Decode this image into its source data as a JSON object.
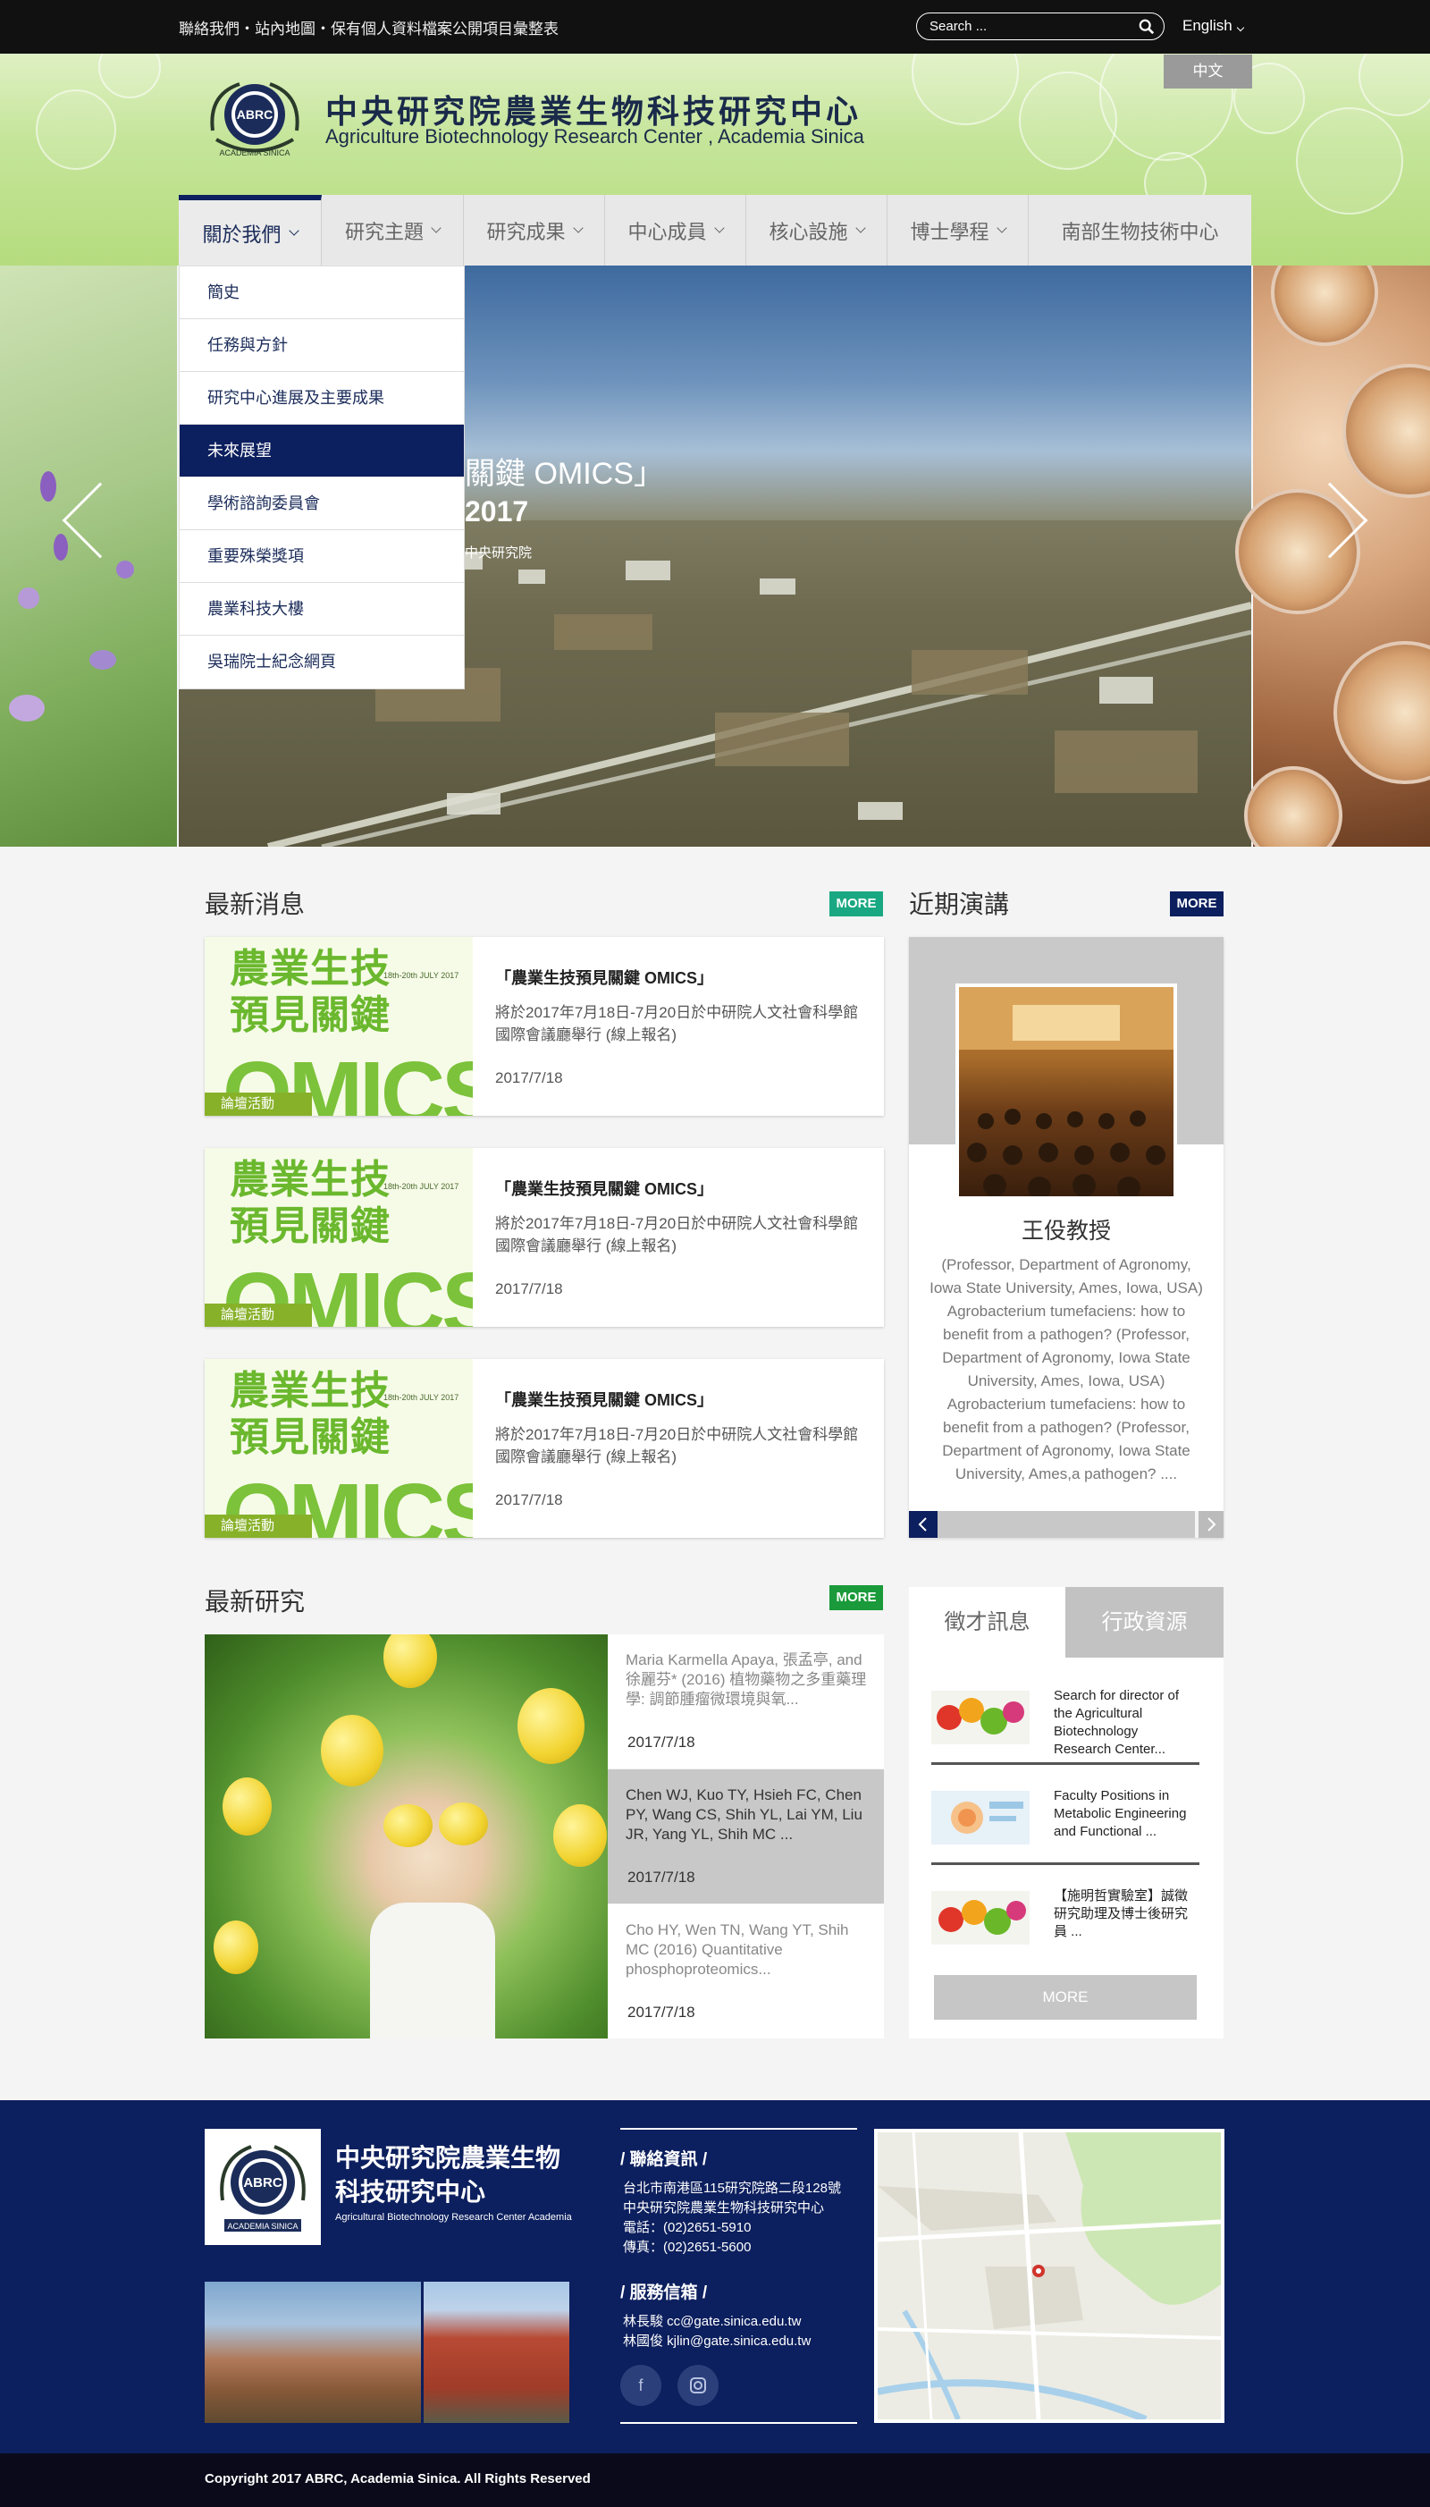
{
  "topbar": {
    "links": "聯絡我們・站內地圖・保有個人資料檔案公開項目彙整表",
    "search_placeholder": "Search ...",
    "language": "English"
  },
  "header": {
    "logo_text_top": "ABRC",
    "logo_text_bottom": "ACADEMIA SINICA",
    "title_cn": "中央研究院農業生物科技研究中心",
    "title_en": "Agriculture Biotechnology Research Center , Academia Sinica",
    "zh_button": "中文"
  },
  "nav": {
    "items": [
      {
        "label": "關於我們",
        "has_sub": true
      },
      {
        "label": "研究主題",
        "has_sub": true
      },
      {
        "label": "研究成果",
        "has_sub": true
      },
      {
        "label": "中心成員",
        "has_sub": true
      },
      {
        "label": "核心設施",
        "has_sub": true
      },
      {
        "label": "博士學程",
        "has_sub": true
      },
      {
        "label": "南部生物技術中心",
        "has_sub": false
      }
    ],
    "active_index": 0
  },
  "dropdown": {
    "items": [
      "簡史",
      "任務與方針",
      "研究中心進展及主要成果",
      "未來展望",
      "學術諮詢委員會",
      "重要殊榮獎項",
      "農業科技大樓",
      "吳瑞院士紀念網頁"
    ],
    "active_index": 3
  },
  "hero": {
    "line1": "關鍵 OMICS」",
    "line2": "2017",
    "line3": "中央研究院"
  },
  "news": {
    "title": "最新消息",
    "more": "MORE",
    "more_color": "#1aa882",
    "image_text_cn": "農業生技\n預見關鍵",
    "image_text_big": "OMICS",
    "image_date": "18th-20th JULY 2017",
    "items": [
      {
        "tag": "論壇活動",
        "title": "「農業生技預見關鍵 OMICS」",
        "desc": "將於2017年7月18日-7月20日於中研院人文社會科學館國際會議廳舉行 (線上報名)",
        "date": "2017/7/18"
      },
      {
        "tag": "論壇活動",
        "title": "「農業生技預見關鍵 OMICS」",
        "desc": "將於2017年7月18日-7月20日於中研院人文社會科學館國際會議廳舉行 (線上報名)",
        "date": "2017/7/18"
      },
      {
        "tag": "論壇活動",
        "title": "「農業生技預見關鍵 OMICS」",
        "desc": "將於2017年7月18日-7月20日於中研院人文社會科學館國際會議廳舉行 (線上報名)",
        "date": "2017/7/18"
      }
    ]
  },
  "lecture": {
    "title": "近期演講",
    "more": "MORE",
    "more_color": "#0c1f5e",
    "name": "王伇教授",
    "affil": "(Professor, Department of Agronomy, Iowa State University, Ames, Iowa, USA)",
    "text": "Agrobacterium tumefaciens: how to benefit from a pathogen?  (Professor, Department of Agronomy, Iowa State University, Ames, Iowa, USA) Agrobacterium tumefaciens: how to benefit from a pathogen?  (Professor, Department of Agronomy, Iowa State University, Ames,a pathogen? ...."
  },
  "research": {
    "title": "最新研究",
    "more": "MORE",
    "more_color": "#1a9a3a",
    "items": [
      {
        "text": "Maria Karmella Apaya, 張孟亭, and 徐麗芬* (2016) 植物藥物之多重藥理學: 調節腫瘤微環境與氧...",
        "date": "2017/7/18",
        "active": false
      },
      {
        "text": "Chen WJ, Kuo TY, Hsieh FC, Chen PY, Wang CS, Shih YL, Lai YM, Liu JR, Yang YL, Shih MC ...",
        "date": "2017/7/18",
        "active": true
      },
      {
        "text": "Cho HY, Wen TN, Wang YT, Shih MC (2016) Quantitative phosphoproteomics...",
        "date": "2017/7/18",
        "active": false
      }
    ]
  },
  "recruit": {
    "tab_active": "徵才訊息",
    "tab_inactive": "行政資源",
    "items": [
      "Search for director of the Agricultural Biotechnology Research Center...",
      "Faculty Positions in Metabolic Engineering and Functional  ...",
      "【施明哲實驗室】誠徵研究助理及博士後研究員 ..."
    ],
    "more": "MORE"
  },
  "footer": {
    "name_cn": "中央研究院農業生物科技研究中心",
    "name_en": "Agricultural Biotechnology Research Center Academia",
    "contact_head": "/ 聯絡資訊 /",
    "address1": "台北市南港區115研究院路二段128號",
    "address2": "中央研究院農業生物科技研究中心",
    "phone": "電話：(02)2651-5910",
    "fax": "傳真：(02)2651-5600",
    "mail_head": "/ 服務信箱 /",
    "mail1": "林長駿  cc@gate.sinica.edu.tw",
    "mail2": "林國俊  kjlin@gate.sinica.edu.tw",
    "copyright": "Copyright 2017 ABRC, Academia Sinica. All Rights Reserved"
  }
}
